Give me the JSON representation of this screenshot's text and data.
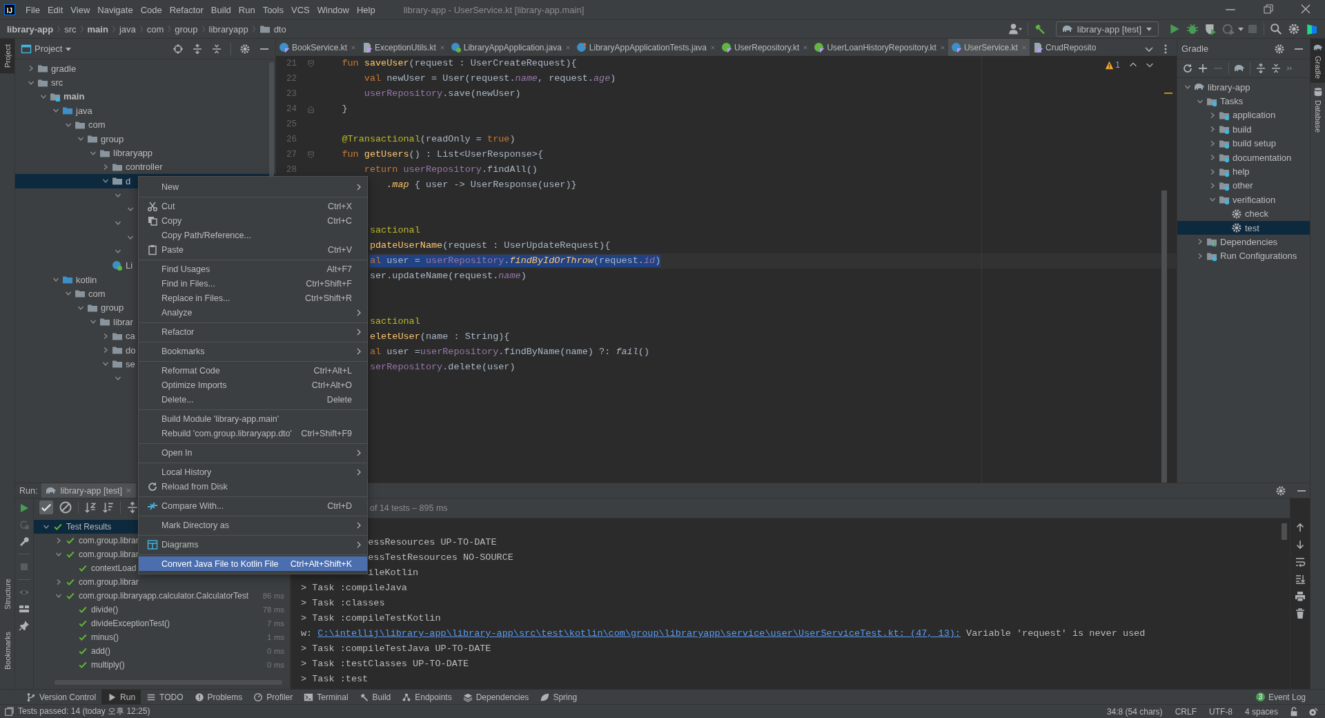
{
  "title_bar": {
    "logo": "IJ",
    "menu": [
      "File",
      "Edit",
      "View",
      "Navigate",
      "Code",
      "Refactor",
      "Build",
      "Run",
      "Tools",
      "VCS",
      "Window",
      "Help"
    ],
    "title": "library-app - UserService.kt [library-app.main]"
  },
  "breadcrumbs": [
    {
      "label": "library-app",
      "bold": true,
      "kind": "plain"
    },
    {
      "label": "src",
      "bold": false,
      "kind": "plain"
    },
    {
      "label": "main",
      "bold": true,
      "kind": "plain"
    },
    {
      "label": "java",
      "bold": false,
      "kind": "plain"
    },
    {
      "label": "com",
      "bold": false,
      "kind": "plain"
    },
    {
      "label": "group",
      "bold": false,
      "kind": "plain"
    },
    {
      "label": "libraryapp",
      "bold": false,
      "kind": "plain"
    },
    {
      "label": "dto",
      "bold": false,
      "kind": "folder"
    }
  ],
  "run_config": "library-app [test]",
  "left_stripe": {
    "top": [
      {
        "label": "Project",
        "selected": true
      }
    ],
    "bottom": [
      {
        "label": "Structure",
        "selected": false
      },
      {
        "label": "Bookmarks",
        "selected": false
      }
    ]
  },
  "right_stripe": [
    {
      "label": "Gradle",
      "selected": true,
      "kind": "elephant"
    },
    {
      "label": "Database",
      "selected": false,
      "kind": "database"
    }
  ],
  "project_panel": {
    "title": "Project",
    "tree": [
      {
        "label": "gradle",
        "kind": "folder",
        "expanded": false,
        "selected": false
      },
      {
        "label": "src",
        "kind": "folder",
        "expanded": true,
        "selected": false,
        "children": [
          {
            "label": "main",
            "kind": "module",
            "bold": true,
            "expanded": true,
            "selected": false,
            "children": [
              {
                "label": "java",
                "kind": "srcfolder",
                "expanded": true,
                "selected": false,
                "children": [
                  {
                    "label": "com",
                    "kind": "folder",
                    "expanded": true,
                    "selected": false,
                    "children": [
                      {
                        "label": "group",
                        "kind": "folder",
                        "expanded": true,
                        "selected": false,
                        "children": [
                          {
                            "label": "libraryapp",
                            "kind": "folder",
                            "expanded": true,
                            "selected": false,
                            "children": [
                              {
                                "label": "controller",
                                "kind": "folder",
                                "expanded": false,
                                "selected": false
                              },
                              {
                                "label": "d",
                                "kind": "folder",
                                "expanded": true,
                                "selected": true,
                                "children": [
                                  {
                                    "expanded": true,
                                    "selected": false,
                                    "children": [
                                      {
                                        "expanded": true,
                                        "selected": false
                                      }
                                    ]
                                  },
                                  {
                                    "expanded": true,
                                    "selected": false,
                                    "children": [
                                      {
                                        "expanded": true,
                                        "selected": false
                                      }
                                    ]
                                  },
                                  {
                                    "expanded": true,
                                    "selected": false
                                  }
                                ]
                              },
                              {
                                "label": "Li",
                                "kind": "app",
                                "selected": false
                              }
                            ]
                          }
                        ]
                      }
                    ]
                  }
                ]
              },
              {
                "label": "kotlin",
                "kind": "srcfolder",
                "expanded": true,
                "selected": false,
                "children": [
                  {
                    "label": "com",
                    "kind": "folder",
                    "expanded": true,
                    "selected": false,
                    "children": [
                      {
                        "label": "group",
                        "kind": "folder",
                        "expanded": true,
                        "selected": false,
                        "children": [
                          {
                            "label": "librar",
                            "kind": "folder",
                            "expanded": true,
                            "selected": false,
                            "children": [
                              {
                                "label": "ca",
                                "kind": "folder",
                                "expanded": false,
                                "selected": false
                              },
                              {
                                "label": "do",
                                "kind": "folder",
                                "expanded": false,
                                "selected": false
                              },
                              {
                                "label": "se",
                                "kind": "folder",
                                "expanded": true,
                                "selected": false,
                                "children": [
                                  {
                                    "expanded": true,
                                    "selected": false
                                  }
                                ]
                              }
                            ]
                          }
                        ]
                      }
                    ]
                  }
                ]
              }
            ]
          }
        ]
      }
    ]
  },
  "editor": {
    "tabs": [
      {
        "label": "BookService.kt",
        "kind": "kclass",
        "selected": false,
        "closable": true
      },
      {
        "label": "ExceptionUtils.kt",
        "kind": "kfile",
        "selected": false,
        "closable": true
      },
      {
        "label": "LibraryAppApplication.java",
        "kind": "app",
        "selected": false,
        "closable": true
      },
      {
        "label": "LibraryAppApplicationTests.java",
        "kind": "jclass",
        "selected": false,
        "closable": true
      },
      {
        "label": "UserRepository.kt",
        "kind": "kinterface",
        "selected": false,
        "closable": true
      },
      {
        "label": "UserLoanHistoryRepository.kt",
        "kind": "kinterface",
        "selected": false,
        "closable": true
      },
      {
        "label": "UserService.kt",
        "kind": "kclass",
        "selected": true,
        "closable": true
      },
      {
        "label": "CrudReposito",
        "kind": "kfile",
        "selected": false,
        "closable": false
      }
    ],
    "warnings": "1",
    "lines": [
      {
        "number": "21",
        "kind": "fold_start",
        "selected": false,
        "tokens": [
          {
            "kind": "kw",
            "text": "    fun "
          },
          {
            "kind": "fn",
            "text": "saveUser"
          },
          {
            "kind": "p",
            "text": "(request : UserCreateRequest){"
          }
        ]
      },
      {
        "number": "22",
        "kind": "code",
        "selected": false,
        "tokens": [
          {
            "kind": "kw",
            "text": "        val "
          },
          {
            "kind": "p",
            "text": "newUser = User(request."
          },
          {
            "kind": "prop",
            "text": "name"
          },
          {
            "kind": "p",
            "text": ", request."
          },
          {
            "kind": "prop",
            "text": "age"
          },
          {
            "kind": "p",
            "text": ")"
          }
        ]
      },
      {
        "number": "23",
        "kind": "code",
        "selected": false,
        "tokens": [
          {
            "kind": "member",
            "text": "        userRepository"
          },
          {
            "kind": "p",
            "text": ".save(newUser)"
          }
        ]
      },
      {
        "number": "24",
        "kind": "fold_end",
        "selected": false,
        "tokens": [
          {
            "kind": "p",
            "text": "    }"
          }
        ]
      },
      {
        "number": "25",
        "kind": "code"
      },
      {
        "number": "26",
        "kind": "code",
        "selected": false,
        "tokens": [
          {
            "kind": "ann",
            "text": "    @Transactional"
          },
          {
            "kind": "p",
            "text": "(readOnly = "
          },
          {
            "kind": "kw",
            "text": "true"
          },
          {
            "kind": "p",
            "text": ")"
          }
        ]
      },
      {
        "number": "27",
        "kind": "fold_start",
        "selected": false,
        "tokens": [
          {
            "kind": "kw",
            "text": "    fun "
          },
          {
            "kind": "fn",
            "text": "getUsers"
          },
          {
            "kind": "p",
            "text": "() : List<UserResponse>{"
          }
        ]
      },
      {
        "number": "28",
        "kind": "code",
        "selected": false,
        "tokens": [
          {
            "kind": "kw",
            "text": "        return "
          },
          {
            "kind": "member",
            "text": "userRepository"
          },
          {
            "kind": "p",
            "text": ".findAll()"
          }
        ]
      },
      {
        "kind": "code",
        "selected": false,
        "tokens": [
          {
            "kind": "ext",
            "text": "            .map"
          },
          {
            "kind": "p",
            "text": " { user -> UserResponse(user)}"
          }
        ]
      },
      {
        "kind": "code"
      },
      {
        "kind": "code"
      },
      {
        "kind": "code",
        "selected": false,
        "tokens": [
          {
            "kind": "ann",
            "text": "         sactional"
          }
        ]
      },
      {
        "kind": "code",
        "selected": false,
        "tokens": [
          {
            "kind": "fn",
            "text": "         pdateUserName"
          },
          {
            "kind": "p",
            "text": "(request : UserUpdateRequest){"
          }
        ]
      },
      {
        "kind": "code",
        "selected": true,
        "tokens": [
          {
            "kind": "kw",
            "text": "         al "
          },
          {
            "kind": "p",
            "text": "user = "
          },
          {
            "kind": "member",
            "text": "userRepository"
          },
          {
            "kind": "p",
            "text": "."
          },
          {
            "kind": "ext",
            "text": "findByIdOrThrow"
          },
          {
            "kind": "p",
            "text": "(request."
          },
          {
            "kind": "prop",
            "text": "id"
          },
          {
            "kind": "p",
            "text": ")"
          }
        ]
      },
      {
        "kind": "code",
        "selected": false,
        "tokens": [
          {
            "kind": "p",
            "text": "         ser.updateName(request."
          },
          {
            "kind": "prop",
            "text": "name"
          },
          {
            "kind": "p",
            "text": ")"
          }
        ]
      },
      {
        "kind": "code"
      },
      {
        "kind": "code"
      },
      {
        "kind": "code",
        "selected": false,
        "tokens": [
          {
            "kind": "ann",
            "text": "         sactional"
          }
        ]
      },
      {
        "kind": "code",
        "selected": false,
        "tokens": [
          {
            "kind": "fn",
            "text": "         eleteUser"
          },
          {
            "kind": "p",
            "text": "(name : String){"
          }
        ]
      },
      {
        "kind": "code",
        "selected": false,
        "tokens": [
          {
            "kind": "kw",
            "text": "         al "
          },
          {
            "kind": "p",
            "text": "user ="
          },
          {
            "kind": "member",
            "text": "userRepository"
          },
          {
            "kind": "p",
            "text": ".findByName(name) ?: "
          },
          {
            "kind": "it",
            "text": "fail"
          },
          {
            "kind": "p",
            "text": "()"
          }
        ]
      },
      {
        "kind": "code",
        "selected": false,
        "tokens": [
          {
            "kind": "member",
            "text": "         serRepository"
          },
          {
            "kind": "p",
            "text": ".delete(user)"
          }
        ]
      }
    ]
  },
  "gradle": {
    "title": "Gradle",
    "tree": [
      {
        "label": "library-app",
        "kind": "elephant",
        "expanded": true,
        "selected": false,
        "children": [
          {
            "label": "Tasks",
            "kind": "taskfolder",
            "expanded": true,
            "selected": false,
            "children": [
              {
                "label": "application",
                "kind": "taskfolder",
                "expanded": false,
                "selected": false
              },
              {
                "label": "build",
                "kind": "taskfolder",
                "expanded": false,
                "selected": false
              },
              {
                "label": "build setup",
                "kind": "taskfolder",
                "expanded": false,
                "selected": false
              },
              {
                "label": "documentation",
                "kind": "taskfolder",
                "expanded": false,
                "selected": false
              },
              {
                "label": "help",
                "kind": "taskfolder",
                "expanded": false,
                "selected": false
              },
              {
                "label": "other",
                "kind": "taskfolder",
                "expanded": false,
                "selected": false
              },
              {
                "label": "verification",
                "kind": "taskfolder",
                "expanded": true,
                "selected": false,
                "children": [
                  {
                    "label": "check",
                    "kind": "gear",
                    "selected": false
                  },
                  {
                    "label": "test",
                    "kind": "gear",
                    "selected": true
                  }
                ]
              }
            ]
          },
          {
            "label": "Dependencies",
            "kind": "deps",
            "expanded": false,
            "selected": false
          },
          {
            "label": "Run Configurations",
            "kind": "taskfolder",
            "expanded": false,
            "selected": false
          }
        ]
      }
    ]
  },
  "context_menu": [
    {
      "kind": "plain",
      "label": "New",
      "submenu": true,
      "selected": false
    },
    {
      "kind": "separator"
    },
    {
      "kind": "cut",
      "label": "Cut",
      "shortcut": "Ctrl+X",
      "submenu": false,
      "selected": false
    },
    {
      "kind": "copy",
      "label": "Copy",
      "shortcut": "Ctrl+C",
      "submenu": false,
      "selected": false
    },
    {
      "kind": "plain",
      "label": "Copy Path/Reference...",
      "submenu": false,
      "selected": false
    },
    {
      "kind": "paste",
      "label": "Paste",
      "shortcut": "Ctrl+V",
      "submenu": false,
      "selected": false
    },
    {
      "kind": "separator"
    },
    {
      "kind": "plain",
      "label": "Find Usages",
      "shortcut": "Alt+F7",
      "submenu": false,
      "selected": false
    },
    {
      "kind": "plain",
      "label": "Find in Files...",
      "shortcut": "Ctrl+Shift+F",
      "submenu": false,
      "selected": false
    },
    {
      "kind": "plain",
      "label": "Replace in Files...",
      "shortcut": "Ctrl+Shift+R",
      "submenu": false,
      "selected": false
    },
    {
      "kind": "plain",
      "label": "Analyze",
      "submenu": true,
      "selected": false
    },
    {
      "kind": "separator"
    },
    {
      "kind": "plain",
      "label": "Refactor",
      "submenu": true,
      "selected": false
    },
    {
      "kind": "separator"
    },
    {
      "kind": "plain",
      "label": "Bookmarks",
      "submenu": true,
      "selected": false
    },
    {
      "kind": "separator"
    },
    {
      "kind": "plain",
      "label": "Reformat Code",
      "shortcut": "Ctrl+Alt+L",
      "submenu": false,
      "selected": false
    },
    {
      "kind": "plain",
      "label": "Optimize Imports",
      "shortcut": "Ctrl+Alt+O",
      "submenu": false,
      "selected": false
    },
    {
      "kind": "plain",
      "label": "Delete...",
      "shortcut": "Delete",
      "submenu": false,
      "selected": false
    },
    {
      "kind": "separator"
    },
    {
      "kind": "plain",
      "label": "Build Module 'library-app.main'",
      "submenu": false,
      "selected": false
    },
    {
      "kind": "plain",
      "label": "Rebuild 'com.group.libraryapp.dto'",
      "shortcut": "Ctrl+Shift+F9",
      "submenu": false,
      "selected": false
    },
    {
      "kind": "separator"
    },
    {
      "kind": "plain",
      "label": "Open In",
      "submenu": true,
      "selected": false
    },
    {
      "kind": "separator"
    },
    {
      "kind": "plain",
      "label": "Local History",
      "submenu": true,
      "selected": false
    },
    {
      "kind": "reload",
      "label": "Reload from Disk",
      "submenu": false,
      "selected": false
    },
    {
      "kind": "separator"
    },
    {
      "kind": "compare",
      "label": "Compare With...",
      "shortcut": "Ctrl+D",
      "submenu": false,
      "selected": false
    },
    {
      "kind": "separator"
    },
    {
      "kind": "plain",
      "label": "Mark Directory as",
      "submenu": true,
      "selected": false
    },
    {
      "kind": "separator"
    },
    {
      "kind": "diagram",
      "label": "Diagrams",
      "submenu": true,
      "selected": false
    },
    {
      "kind": "separator"
    },
    {
      "kind": "plain",
      "label": "Convert Java File to Kotlin File",
      "shortcut": "Ctrl+Alt+Shift+K",
      "submenu": false,
      "selected": true
    }
  ],
  "run_panel": {
    "label": "Run:",
    "tab": "library-app [test]",
    "summary": "of 14 tests – 895 ms",
    "tests": [
      {
        "label": "Test Results",
        "expanded": true,
        "passed": true,
        "selected": true,
        "children": [
          {
            "label": "com.group.librar",
            "expanded": false,
            "passed": true,
            "selected": false
          },
          {
            "label": "com.group.librar",
            "expanded": true,
            "passed": true,
            "selected": false,
            "children": [
              {
                "label": "contextLoad",
                "passed": true,
                "selected": false
              }
            ]
          },
          {
            "label": "com.group.librar",
            "expanded": false,
            "passed": true,
            "selected": false
          },
          {
            "label": "com.group.libraryapp.calculator.CalculatorTest",
            "time": "86 ms",
            "expanded": true,
            "passed": true,
            "selected": false,
            "children": [
              {
                "label": "divide()",
                "time": "78 ms",
                "passed": true,
                "selected": false
              },
              {
                "label": "divideExceptionTest()",
                "time": "7 ms",
                "passed": true,
                "selected": false
              },
              {
                "label": "minus()",
                "time": "1 ms",
                "passed": true,
                "selected": false
              },
              {
                "label": "add()",
                "time": "0 ms",
                "passed": true,
                "selected": false
              },
              {
                "label": "multiply()",
                "time": "0 ms",
                "passed": true,
                "selected": false
              }
            ]
          }
        ]
      }
    ],
    "console": [
      {
        "kind": "plain",
        "text": "            essResources UP-TO-DATE"
      },
      {
        "kind": "plain",
        "text": "            essTestResources NO-SOURCE"
      },
      {
        "kind": "plain",
        "text": "            ileKotlin"
      },
      {
        "kind": "plain",
        "text": "> Task :compileJava"
      },
      {
        "kind": "plain",
        "text": "> Task :classes"
      },
      {
        "kind": "plain",
        "text": "> Task :compileTestKotlin"
      },
      {
        "kind": "warning",
        "prefix": "w: ",
        "link": "C:\\intellij\\library-app\\library-app\\src\\test\\kotlin\\com\\group\\libraryapp\\service\\user\\UserServiceTest.kt: (47, 13):",
        "text": " Variable 'request' is never used"
      },
      {
        "kind": "plain",
        "text": "> Task :compileTestJava UP-TO-DATE"
      },
      {
        "kind": "plain",
        "text": "> Task :testClasses UP-TO-DATE"
      },
      {
        "kind": "plain",
        "text": "> Task :test"
      }
    ]
  },
  "tool_windows": [
    {
      "label": "Version Control",
      "kind": "vcs",
      "selected": false
    },
    {
      "label": "Run",
      "kind": "run",
      "selected": true
    },
    {
      "label": "TODO",
      "kind": "list",
      "selected": false
    },
    {
      "label": "Problems",
      "kind": "info",
      "selected": false
    },
    {
      "label": "Profiler",
      "kind": "profiler",
      "selected": false
    },
    {
      "label": "Terminal",
      "kind": "terminal",
      "selected": false
    },
    {
      "label": "Build",
      "kind": "hammer",
      "selected": false
    },
    {
      "label": "Endpoints",
      "kind": "endpoints",
      "selected": false
    },
    {
      "label": "Dependencies",
      "kind": "layers",
      "selected": false
    },
    {
      "label": "Spring",
      "kind": "leaf",
      "selected": false
    }
  ],
  "event_log": {
    "count": "3",
    "label": "Event Log"
  },
  "status_bar": {
    "message": "Tests passed: 14 (today 오후 12:25)",
    "position": "34:8 (54 chars)",
    "line_separator": "CRLF",
    "encoding": "UTF-8",
    "indent": "4 spaces"
  }
}
